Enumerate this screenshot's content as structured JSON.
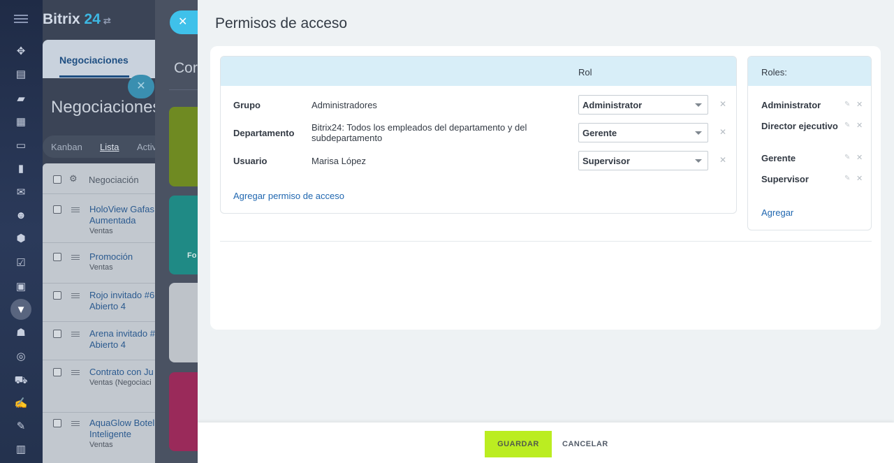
{
  "background": {
    "logo": {
      "name": "Bitrix",
      "num": "24"
    },
    "active_tab": "Negociaciones",
    "title": "Negociaciones",
    "views": [
      "Kanban",
      "Lista",
      "Activ"
    ],
    "list_header": "Negociación",
    "rows": [
      {
        "title_1": "HoloView Gafas",
        "title_2": "Aumentada",
        "sub": "Ventas"
      },
      {
        "title_1": "Promoción",
        "title_2": "",
        "sub": "Ventas"
      },
      {
        "title_1": "Rojo invitado #6",
        "title_2": "Abierto 4",
        "sub": ""
      },
      {
        "title_1": "Arena invitado #",
        "title_2": "Abierto 4",
        "sub": ""
      },
      {
        "title_1": "Contrato con Ju",
        "title_2": "",
        "sub": "Ventas (Negociaci"
      },
      {
        "title_1": "AquaGlow Botel",
        "title_2": "Inteligente",
        "sub": "Ventas"
      }
    ],
    "mid_title": "Cor",
    "mid_card_text": "Fo"
  },
  "slider": {
    "title": "Permisos de acceso",
    "permissions": {
      "role_column": "Rol",
      "rows": [
        {
          "kind": "Grupo",
          "who": "Administradores",
          "role": "Administrator"
        },
        {
          "kind": "Departamento",
          "who": "Bitrix24: Todos los empleados del departamento y del subdepartamento",
          "role": "Gerente"
        },
        {
          "kind": "Usuario",
          "who": "Marisa López",
          "role": "Supervisor"
        }
      ],
      "add_link": "Agregar permiso de acceso"
    },
    "roles": {
      "header": "Roles:",
      "items": [
        "Administrator",
        "Director ejecutivo",
        "Gerente",
        "Supervisor"
      ],
      "add_link": "Agregar"
    },
    "footer": {
      "save": "GUARDAR",
      "cancel": "CANCELAR"
    }
  }
}
